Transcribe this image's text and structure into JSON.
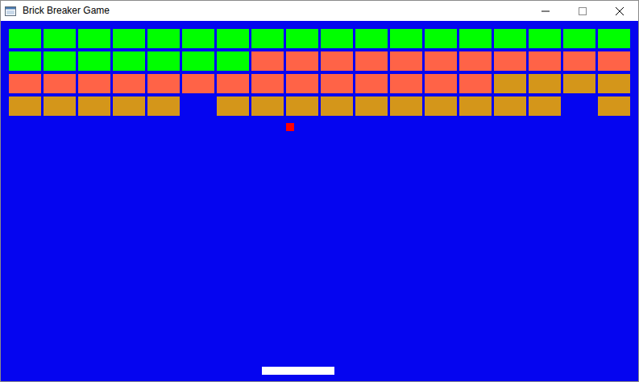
{
  "window": {
    "title": "Brick Breaker Game"
  },
  "bricks": {
    "rows": [
      [
        {
          "color": "#00ff00",
          "broken": false
        },
        {
          "color": "#00ff00",
          "broken": false
        },
        {
          "color": "#00ff00",
          "broken": false
        },
        {
          "color": "#00ff00",
          "broken": false
        },
        {
          "color": "#00ff00",
          "broken": false
        },
        {
          "color": "#00ff00",
          "broken": false
        },
        {
          "color": "#00ff00",
          "broken": false
        },
        {
          "color": "#00ff00",
          "broken": false
        },
        {
          "color": "#00ff00",
          "broken": false
        },
        {
          "color": "#00ff00",
          "broken": false
        },
        {
          "color": "#00ff00",
          "broken": false
        },
        {
          "color": "#00ff00",
          "broken": false
        },
        {
          "color": "#00ff00",
          "broken": false
        },
        {
          "color": "#00ff00",
          "broken": false
        },
        {
          "color": "#00ff00",
          "broken": false
        },
        {
          "color": "#00ff00",
          "broken": false
        },
        {
          "color": "#00ff00",
          "broken": false
        },
        {
          "color": "#00ff00",
          "broken": false
        }
      ],
      [
        {
          "color": "#00ff00",
          "broken": false
        },
        {
          "color": "#00ff00",
          "broken": false
        },
        {
          "color": "#00ff00",
          "broken": false
        },
        {
          "color": "#00ff00",
          "broken": false
        },
        {
          "color": "#00ff00",
          "broken": false
        },
        {
          "color": "#00ff00",
          "broken": false
        },
        {
          "color": "#00ff00",
          "broken": false
        },
        {
          "color": "#ff6347",
          "broken": false
        },
        {
          "color": "#ff6347",
          "broken": false
        },
        {
          "color": "#ff6347",
          "broken": false
        },
        {
          "color": "#ff6347",
          "broken": false
        },
        {
          "color": "#ff6347",
          "broken": false
        },
        {
          "color": "#ff6347",
          "broken": false
        },
        {
          "color": "#ff6347",
          "broken": false
        },
        {
          "color": "#ff6347",
          "broken": false
        },
        {
          "color": "#ff6347",
          "broken": false
        },
        {
          "color": "#ff6347",
          "broken": false
        },
        {
          "color": "#ff6347",
          "broken": false
        }
      ],
      [
        {
          "color": "#ff6347",
          "broken": false
        },
        {
          "color": "#ff6347",
          "broken": false
        },
        {
          "color": "#ff6347",
          "broken": false
        },
        {
          "color": "#ff6347",
          "broken": false
        },
        {
          "color": "#ff6347",
          "broken": false
        },
        {
          "color": "#ff6347",
          "broken": false
        },
        {
          "color": "#ff6347",
          "broken": false
        },
        {
          "color": "#ff6347",
          "broken": false
        },
        {
          "color": "#ff6347",
          "broken": false
        },
        {
          "color": "#ff6347",
          "broken": false
        },
        {
          "color": "#ff6347",
          "broken": false
        },
        {
          "color": "#ff6347",
          "broken": false
        },
        {
          "color": "#ff6347",
          "broken": false
        },
        {
          "color": "#ff6347",
          "broken": false
        },
        {
          "color": "#d4961a",
          "broken": false
        },
        {
          "color": "#d4961a",
          "broken": false
        },
        {
          "color": "#d4961a",
          "broken": false
        },
        {
          "color": "#d4961a",
          "broken": false
        }
      ],
      [
        {
          "color": "#d4961a",
          "broken": false
        },
        {
          "color": "#d4961a",
          "broken": false
        },
        {
          "color": "#d4961a",
          "broken": false
        },
        {
          "color": "#d4961a",
          "broken": false
        },
        {
          "color": "#d4961a",
          "broken": false
        },
        {
          "color": "#d4961a",
          "broken": true
        },
        {
          "color": "#d4961a",
          "broken": false
        },
        {
          "color": "#d4961a",
          "broken": false
        },
        {
          "color": "#d4961a",
          "broken": false
        },
        {
          "color": "#d4961a",
          "broken": false
        },
        {
          "color": "#d4961a",
          "broken": false
        },
        {
          "color": "#d4961a",
          "broken": false
        },
        {
          "color": "#d4961a",
          "broken": false
        },
        {
          "color": "#d4961a",
          "broken": false
        },
        {
          "color": "#d4961a",
          "broken": false
        },
        {
          "color": "#d4961a",
          "broken": false
        },
        {
          "color": "#d4961a",
          "broken": true
        },
        {
          "color": "#d4961a",
          "broken": false
        }
      ]
    ]
  }
}
